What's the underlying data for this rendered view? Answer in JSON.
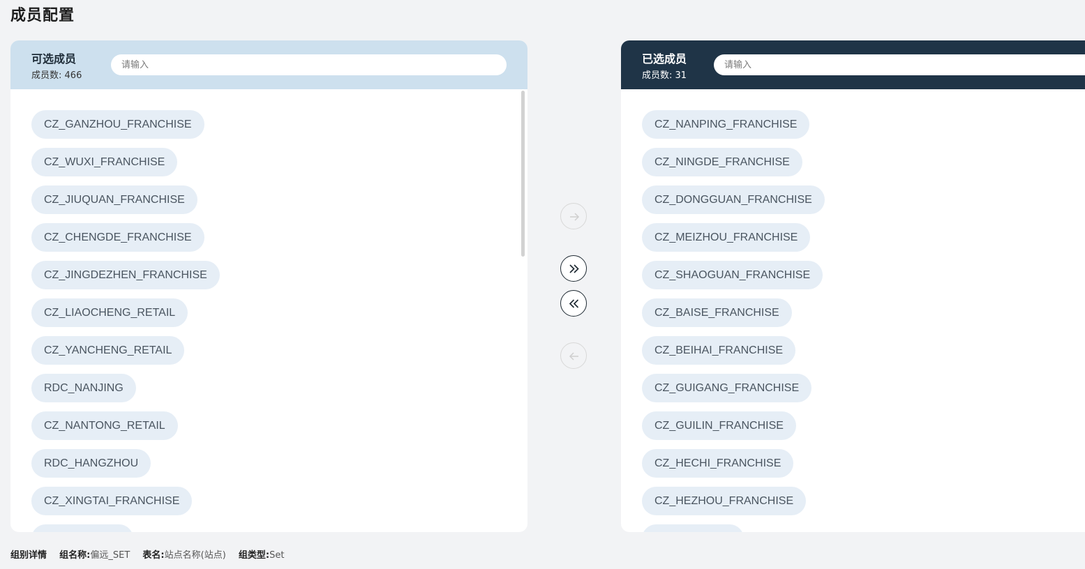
{
  "page": {
    "title": "成员配置"
  },
  "available": {
    "title": "可选成员",
    "count_label": "成员数:",
    "count": "466",
    "search_placeholder": "请输入",
    "items": [
      "CZ_GANZHOU_FRANCHISE",
      "CZ_WUXI_FRANCHISE",
      "CZ_JIUQUAN_FRANCHISE",
      "CZ_CHENGDE_FRANCHISE",
      "CZ_JINGDEZHEN_FRANCHISE",
      "CZ_LIAOCHENG_RETAIL",
      "CZ_YANCHENG_RETAIL",
      "RDC_NANJING",
      "CZ_NANTONG_RETAIL",
      "RDC_HANGZHOU",
      "CZ_XINGTAI_FRANCHISE",
      ""
    ]
  },
  "selected": {
    "title": "已选成员",
    "count_label": "成员数:",
    "count": "31",
    "search_placeholder": "请输入",
    "items": [
      "CZ_NANPING_FRANCHISE",
      "CZ_NINGDE_FRANCHISE",
      "CZ_DONGGUAN_FRANCHISE",
      "CZ_MEIZHOU_FRANCHISE",
      "CZ_SHAOGUAN_FRANCHISE",
      "CZ_BAISE_FRANCHISE",
      "CZ_BEIHAI_FRANCHISE",
      "CZ_GUIGANG_FRANCHISE",
      "CZ_GUILIN_FRANCHISE",
      "CZ_HECHI_FRANCHISE",
      "CZ_HEZHOU_FRANCHISE",
      ""
    ]
  },
  "transfer": {
    "move_right_icon": "arrow-right-icon",
    "move_all_right_icon": "double-chevron-right-icon",
    "move_all_left_icon": "double-chevron-left-icon",
    "move_left_icon": "arrow-left-icon"
  },
  "footer": {
    "section_label": "组别详情",
    "group_name_label": "组名称:",
    "group_name": "偏远_SET",
    "table_label": "表名:",
    "table_name": "站点名称(站点)",
    "group_type_label": "组类型:",
    "group_type": "Set"
  },
  "colors": {
    "left_header": "#cde0ee",
    "right_header": "#1f3447",
    "chip_bg": "#e6eef6",
    "page_bg": "#f2f3f5"
  }
}
